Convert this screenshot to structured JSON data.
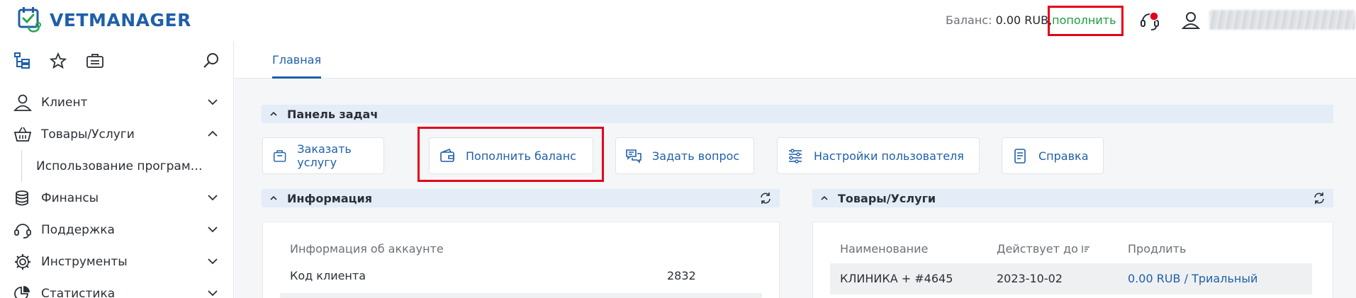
{
  "brand": {
    "name": "VETMANAGER"
  },
  "header": {
    "balance_label": "Баланс:",
    "balance_amount": "0.00 RUB,",
    "topup_link": "пополнить"
  },
  "sidebar": {
    "menu": [
      {
        "label": "Клиент",
        "icon": "client-icon",
        "expanded": false
      },
      {
        "label": "Товары/Услуги",
        "icon": "basket-icon",
        "expanded": true
      },
      {
        "label": "Финансы",
        "icon": "coins-icon",
        "expanded": false
      },
      {
        "label": "Поддержка",
        "icon": "headset-icon",
        "expanded": false
      },
      {
        "label": "Инструменты",
        "icon": "gear-icon",
        "expanded": false
      },
      {
        "label": "Статистика",
        "icon": "pie-chart-icon",
        "expanded": false
      }
    ],
    "submenu": [
      {
        "label": "Использование програм…"
      }
    ]
  },
  "tabs": [
    {
      "label": "Главная",
      "active": true
    }
  ],
  "sections": {
    "tasks": {
      "title": "Панель задач"
    },
    "info": {
      "title": "Информация"
    },
    "goods": {
      "title": "Товары/Услуги"
    }
  },
  "task_buttons": [
    {
      "label": "Заказать услугу",
      "icon": "bag-icon"
    },
    {
      "label": "Пополнить баланс",
      "icon": "wallet-icon"
    },
    {
      "label": "Задать вопрос",
      "icon": "chat-icon"
    },
    {
      "label": "Настройки пользователя",
      "icon": "settings-list-icon"
    },
    {
      "label": "Справка",
      "icon": "document-icon"
    }
  ],
  "info_panel": {
    "heading": "Информация об аккаунте",
    "rows": [
      {
        "label": "Код клиента",
        "value": "2832"
      }
    ]
  },
  "goods_panel": {
    "columns": [
      "Наименование",
      "Действует до",
      "Продлить"
    ],
    "rows": [
      {
        "name": "КЛИНИКА + #4645",
        "valid_until": "2023-10-02",
        "renew_amount": "0.00 RUB",
        "renew_sep": " / ",
        "renew_plan": "Триальный"
      }
    ]
  },
  "colors": {
    "brand": "#1f5fa8",
    "topup": "#1c9d3e",
    "highlight": "#e3001b",
    "notification_badge": "#e3001b"
  }
}
